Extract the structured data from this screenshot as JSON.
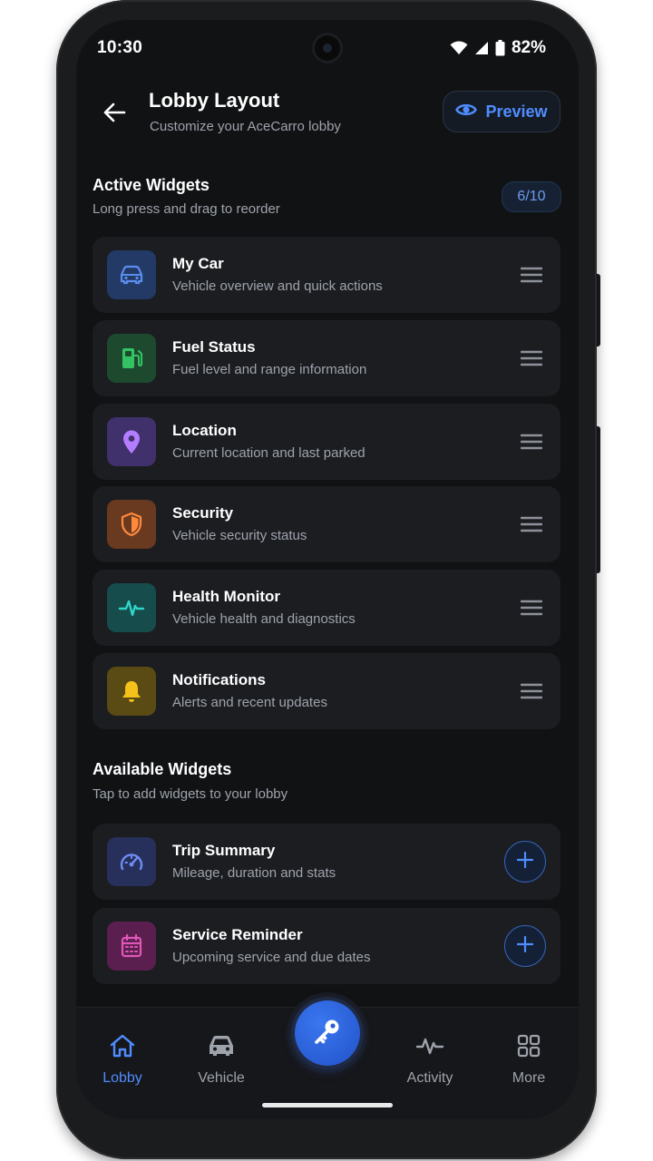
{
  "status_bar": {
    "time": "10:30",
    "battery": "82%"
  },
  "header": {
    "title": "Lobby Layout",
    "subtitle": "Customize your AceCarro lobby",
    "preview_label": "Preview"
  },
  "active_section": {
    "title": "Active Widgets",
    "subtitle": "Long press and drag to reorder",
    "count": "6/10",
    "widgets": [
      {
        "name": "My Car",
        "desc": "Vehicle overview and quick actions",
        "icon": "car-icon",
        "color": "#5b8def"
      },
      {
        "name": "Fuel Status",
        "desc": "Fuel level and range information",
        "icon": "fuel-pump-icon",
        "color": "#34c363"
      },
      {
        "name": "Location",
        "desc": "Current location and last parked",
        "icon": "map-pin-icon",
        "color": "#b47dff"
      },
      {
        "name": "Security",
        "desc": "Vehicle security status",
        "icon": "shield-icon",
        "color": "#ff8a3d"
      },
      {
        "name": "Health Monitor",
        "desc": "Vehicle health and diagnostics",
        "icon": "heartbeat-icon",
        "color": "#2fd6c8"
      },
      {
        "name": "Notifications",
        "desc": "Alerts and recent updates",
        "icon": "bell-icon",
        "color": "#f4c21a"
      }
    ]
  },
  "available_section": {
    "title": "Available Widgets",
    "subtitle": "Tap to add widgets to your lobby",
    "widgets": [
      {
        "name": "Trip Summary",
        "desc": "Mileage, duration and stats",
        "icon": "speedometer-icon",
        "color": "#6f8cf5"
      },
      {
        "name": "Service Reminder",
        "desc": "Upcoming service and due dates",
        "icon": "calendar-icon",
        "color": "#e157b8"
      }
    ]
  },
  "bottom_nav": {
    "items": [
      {
        "label": "Lobby",
        "icon": "home-icon",
        "active": true
      },
      {
        "label": "Vehicle",
        "icon": "car-icon",
        "active": false
      },
      {
        "label": "Activity",
        "icon": "activity-icon",
        "active": false
      },
      {
        "label": "More",
        "icon": "grid-icon",
        "active": false
      }
    ],
    "center_action_icon": "key-icon"
  },
  "colors": {
    "accent": "#4f8dff",
    "background": "#111214",
    "card": "#1b1d21"
  }
}
